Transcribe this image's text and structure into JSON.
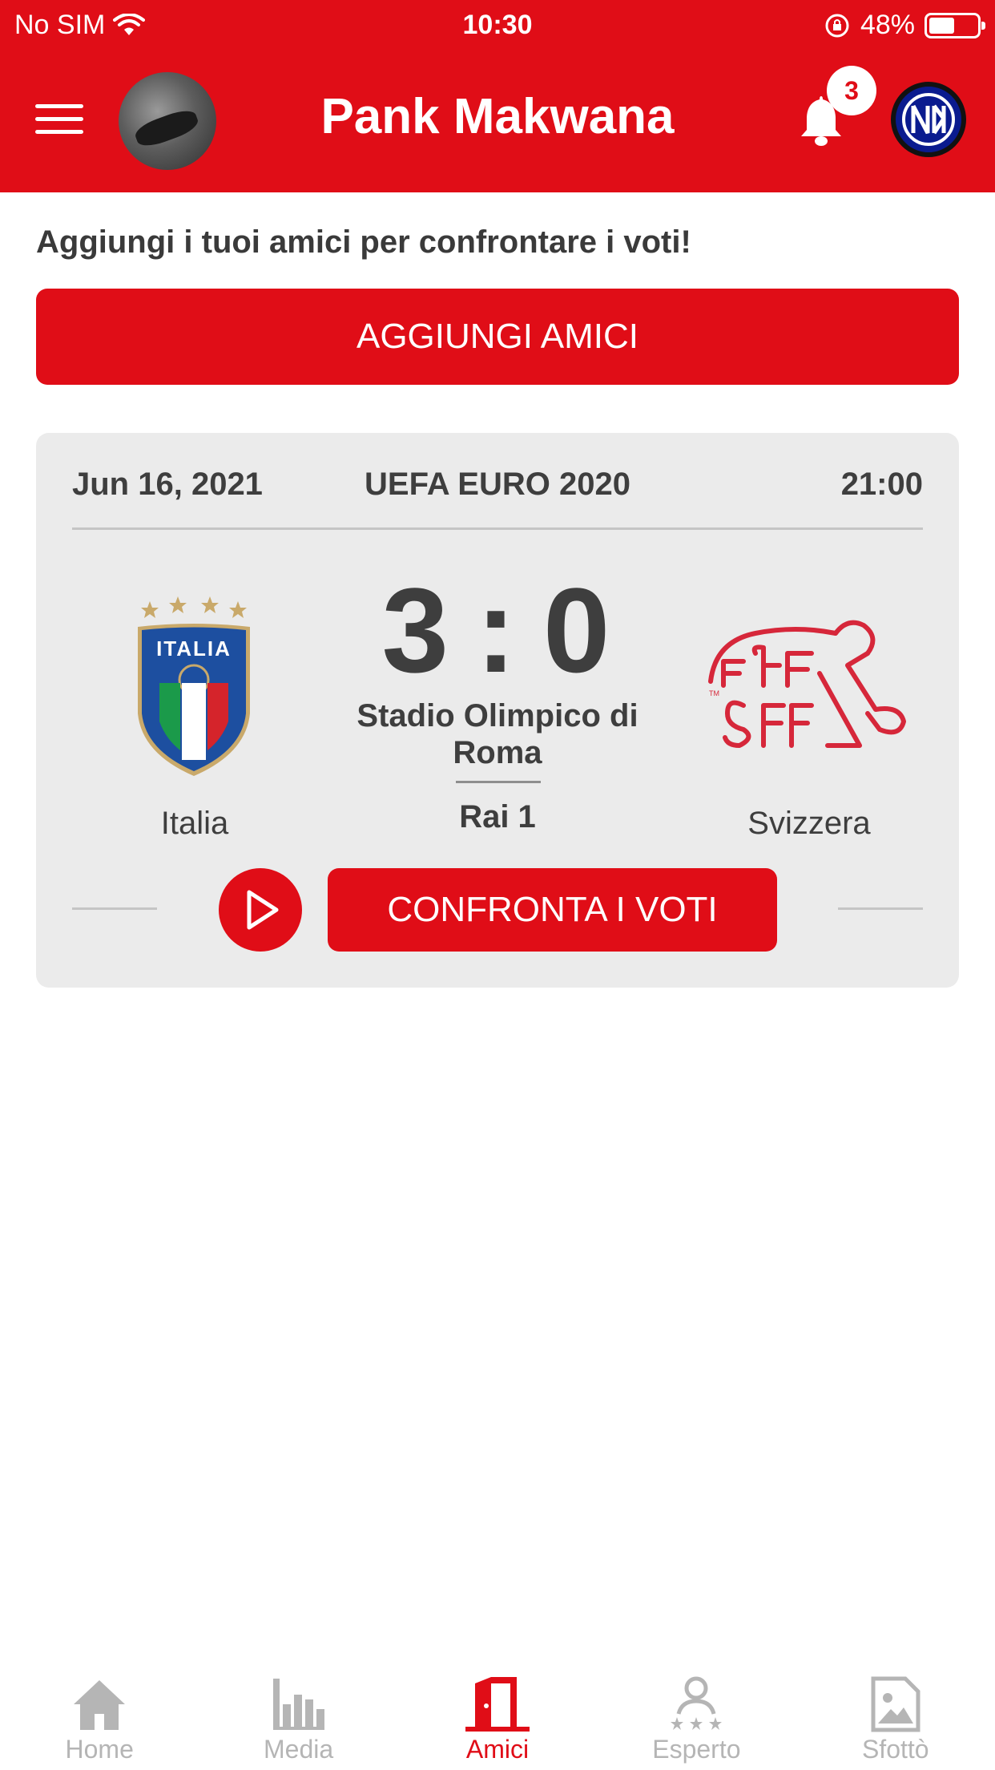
{
  "status_bar": {
    "carrier": "No SIM",
    "time": "10:30",
    "battery": "48%",
    "battery_level": 0.48
  },
  "header": {
    "title": "Pank Makwana",
    "notification_count": "3",
    "menu_icon": "hamburger-menu-icon",
    "bell_icon": "bell-icon",
    "club_logo": "inter-logo"
  },
  "invite": {
    "text": "Aggiungi i tuoi amici per confrontare i voti!",
    "button_label": "AGGIUNGI AMICI"
  },
  "match": {
    "date": "Jun 16, 2021",
    "competition": "UEFA EURO 2020",
    "time": "21:00",
    "home_team": "Italia",
    "away_team": "Svizzera",
    "home_score": "3",
    "separator": ":",
    "away_score": "0",
    "venue": "Stadio Olimpico di Roma",
    "broadcaster": "Rai 1",
    "compare_label": "CONFRONTA I VOTI"
  },
  "tabs": [
    {
      "label": "Home",
      "icon": "home-icon",
      "active": false
    },
    {
      "label": "Media",
      "icon": "bar-chart-icon",
      "active": false
    },
    {
      "label": "Amici",
      "icon": "door-icon",
      "active": true
    },
    {
      "label": "Esperto",
      "icon": "expert-stars-icon",
      "active": false
    },
    {
      "label": "Sfottò",
      "icon": "image-icon",
      "active": false
    }
  ],
  "colors": {
    "brand_red": "#e00d17",
    "card_bg": "#ebebeb",
    "text_dark": "#3e3e3e",
    "tab_inactive": "#b5b5b5"
  }
}
